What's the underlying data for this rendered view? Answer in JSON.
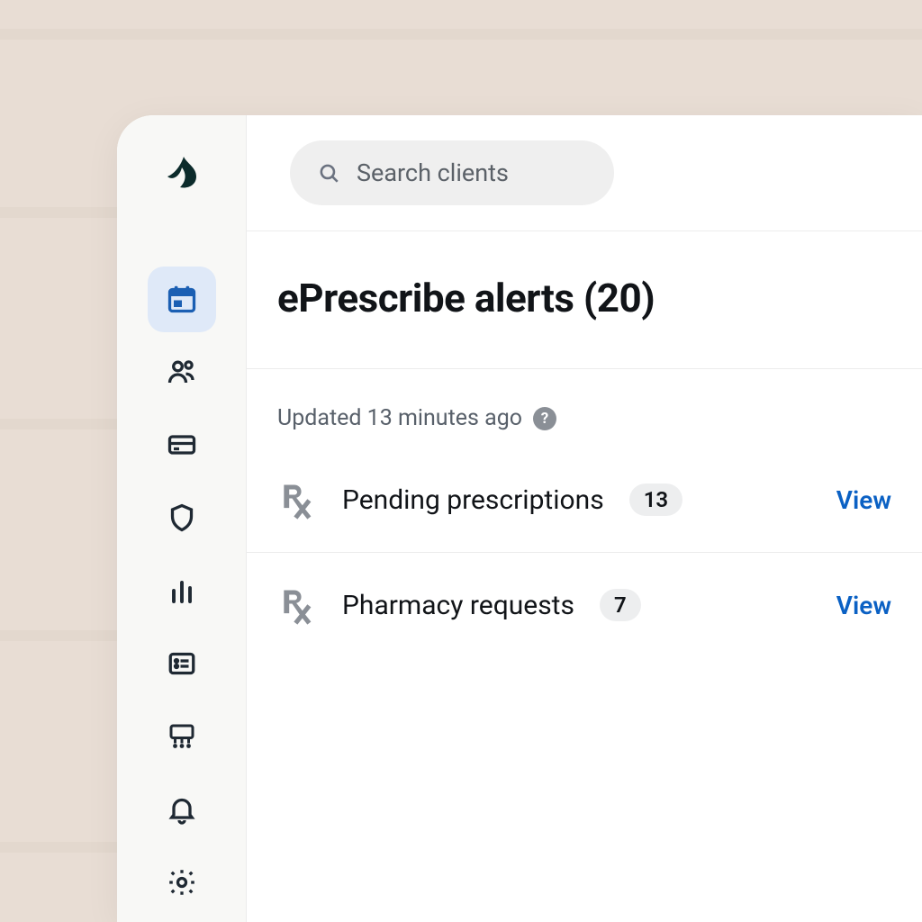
{
  "search": {
    "placeholder": "Search clients"
  },
  "page": {
    "title_prefix": "ePrescribe alerts",
    "total_count": 20,
    "updated_text": "Updated 13 minutes ago",
    "help_glyph": "?"
  },
  "alerts": [
    {
      "label": "Pending prescriptions",
      "count": 13,
      "action_label": "View"
    },
    {
      "label": "Pharmacy requests",
      "count": 7,
      "action_label": "View"
    }
  ],
  "sidebar": {
    "items": [
      {
        "name": "calendar",
        "selected": true
      },
      {
        "name": "clients",
        "selected": false
      },
      {
        "name": "billing",
        "selected": false
      },
      {
        "name": "security",
        "selected": false
      },
      {
        "name": "analytics",
        "selected": false
      },
      {
        "name": "forms",
        "selected": false
      },
      {
        "name": "team",
        "selected": false
      },
      {
        "name": "notifications",
        "selected": false
      },
      {
        "name": "settings",
        "selected": false
      }
    ]
  },
  "colors": {
    "accent": "#1b5fb3",
    "link": "#0b61c4"
  }
}
